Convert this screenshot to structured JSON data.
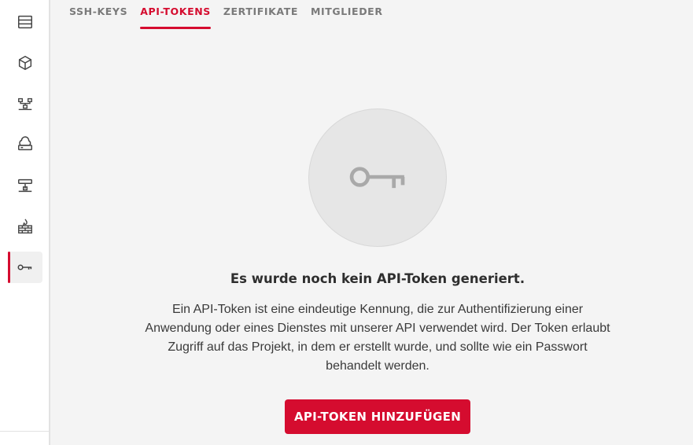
{
  "sidebar": {
    "items": [
      {
        "icon": "server-icon"
      },
      {
        "icon": "cube-icon"
      },
      {
        "icon": "network-icon"
      },
      {
        "icon": "cloud-storage-icon"
      },
      {
        "icon": "network-switch-icon"
      },
      {
        "icon": "firewall-icon"
      },
      {
        "icon": "key-icon",
        "active": true
      }
    ]
  },
  "tabs": [
    {
      "label": "SSH-KEYS"
    },
    {
      "label": "API-TOKENS",
      "active": true
    },
    {
      "label": "ZERTIFIKATE"
    },
    {
      "label": "MITGLIEDER"
    }
  ],
  "empty_state": {
    "icon": "key-icon",
    "title": "Es wurde noch kein API-Token generiert.",
    "description": "Ein API-Token ist eine eindeutige Kennung, die zur Authentifizierung einer Anwendung oder eines Dienstes mit unserer API verwendet wird. Der Token erlaubt Zugriff auf das Projekt, in dem er erstellt wurde, und sollte wie ein Passwort behandelt werden.",
    "button_label": "API-TOKEN HINZUFÜGEN"
  },
  "colors": {
    "accent": "#d50c2f",
    "background": "#f4f4f4",
    "sidebar": "#ffffff"
  }
}
